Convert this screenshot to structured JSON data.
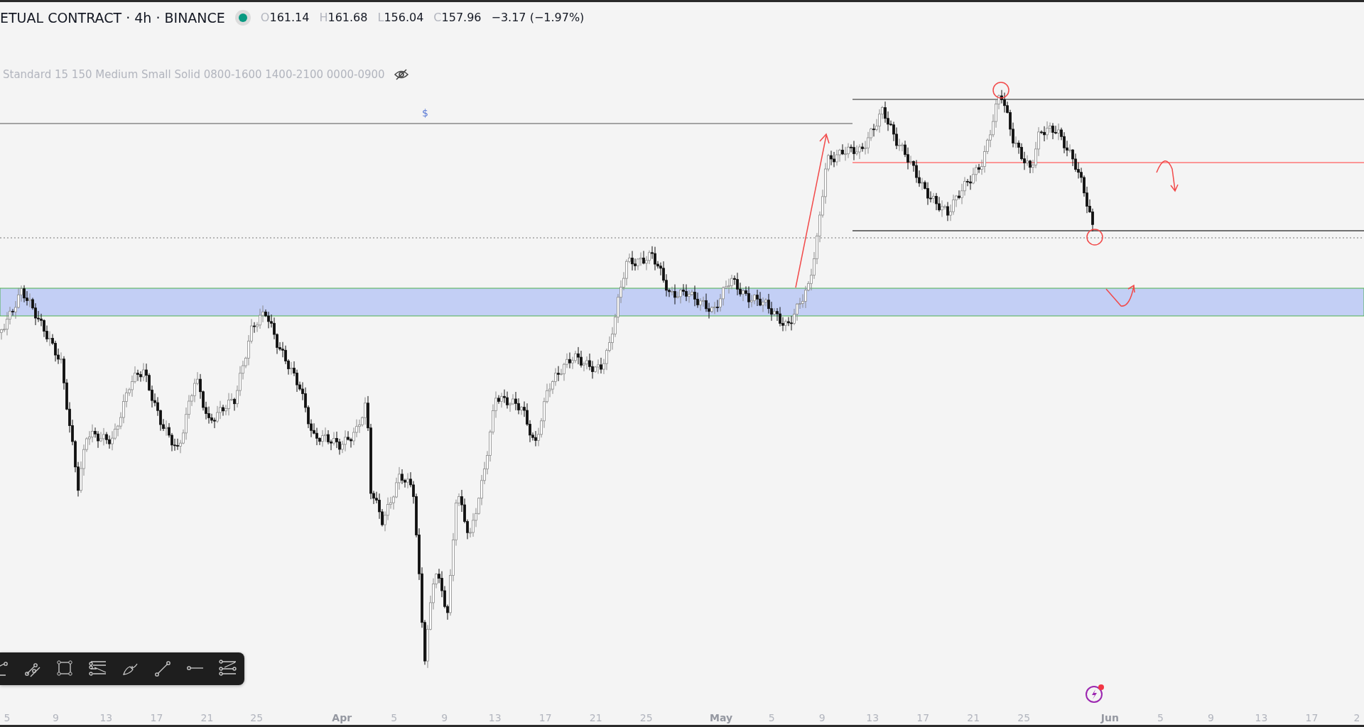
{
  "header": {
    "title": "ETUAL CONTRACT · 4h · BINANCE",
    "ohlc": [
      {
        "label": "O",
        "value": "161.14"
      },
      {
        "label": "H",
        "value": "161.68"
      },
      {
        "label": "L",
        "value": "156.04"
      },
      {
        "label": "C",
        "value": "157.96"
      }
    ],
    "change": "−3.17 (−1.97%)"
  },
  "indicator": {
    "text": "Standard 15 150 Medium Small Solid 0800-1600 1400-2100 0000-0900",
    "hidden": true
  },
  "chart": {
    "marker_text": "$"
  },
  "toolbar": {
    "tools": [
      {
        "kind": "angle"
      },
      {
        "kind": "parallel"
      },
      {
        "kind": "rectangle"
      },
      {
        "kind": "fib"
      },
      {
        "kind": "brush"
      },
      {
        "kind": "trendline"
      },
      {
        "kind": "ray"
      },
      {
        "kind": "pitchfork"
      }
    ]
  },
  "time_axis": {
    "labels": [
      "5",
      "9",
      "13",
      "17",
      "21",
      "25",
      "Apr",
      "5",
      "9",
      "13",
      "17",
      "21",
      "25",
      "May",
      "5",
      "9",
      "13",
      "17",
      "21",
      "25",
      "Jun",
      "5",
      "9",
      "13",
      "17",
      "2"
    ]
  }
}
